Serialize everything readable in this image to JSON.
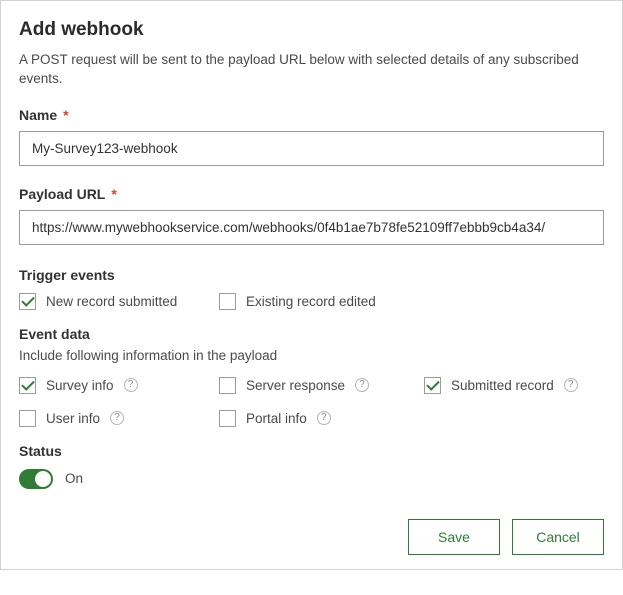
{
  "title": "Add webhook",
  "description": "A POST request will be sent to the payload URL below with selected details of any subscribed events.",
  "name": {
    "label": "Name",
    "required": "*",
    "value": "My-Survey123-webhook"
  },
  "payload": {
    "label": "Payload URL",
    "required": "*",
    "value": "https://www.mywebhookservice.com/webhooks/0f4b1ae7b78fe52109ff7ebbb9cb4a34/"
  },
  "trigger": {
    "label": "Trigger events",
    "options": {
      "new_record": {
        "label": "New record submitted",
        "checked": true
      },
      "existing_record": {
        "label": "Existing record edited",
        "checked": false
      }
    }
  },
  "eventData": {
    "label": "Event data",
    "sub": "Include following information in the payload",
    "options": {
      "survey_info": {
        "label": "Survey info",
        "checked": true
      },
      "server_response": {
        "label": "Server response",
        "checked": false
      },
      "submitted_record": {
        "label": "Submitted record",
        "checked": true
      },
      "user_info": {
        "label": "User info",
        "checked": false
      },
      "portal_info": {
        "label": "Portal info",
        "checked": false
      }
    }
  },
  "status": {
    "label": "Status",
    "value": "On",
    "on": true
  },
  "footer": {
    "save": "Save",
    "cancel": "Cancel"
  },
  "help_glyph": "?"
}
